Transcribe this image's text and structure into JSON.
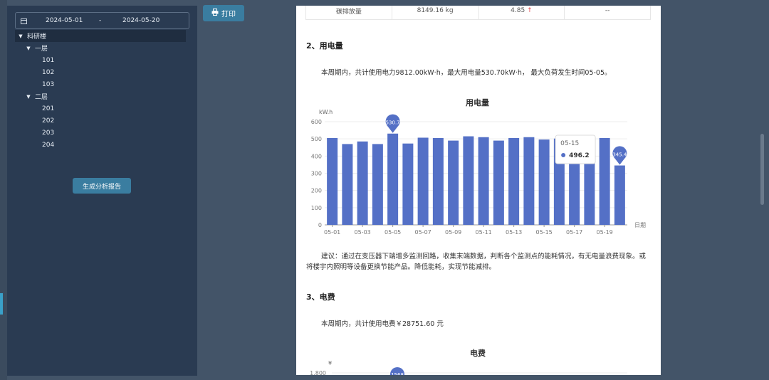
{
  "sidebar": {
    "date_from": "2024-05-01",
    "date_sep": "-",
    "date_to": "2024-05-20",
    "tree": {
      "root": "科研楼",
      "floors": [
        {
          "label": "一层",
          "rooms": [
            "101",
            "102",
            "103"
          ]
        },
        {
          "label": "二层",
          "rooms": [
            "201",
            "202",
            "203",
            "204"
          ]
        }
      ]
    },
    "generate_label": "生成分析报告"
  },
  "toolbar": {
    "print_label": "打印"
  },
  "report": {
    "table_row": {
      "name": "碳排放量",
      "value": "8149.16 kg",
      "change": "4.85",
      "trend_arrow": "↑",
      "last": "--"
    },
    "section2": {
      "title": "2、用电量",
      "summary": "本周期内，共计使用电力9812.00kW·h，最大用电量530.70kW·h，  最大负荷发生时间05-05。",
      "advice": "建议：通过在变压器下端增多监测回路，收集末端数据，判断各个监测点的能耗情况，有无电量浪费现象。或将楼宇内照明等设备更换节能产品。降低能耗，实现节能减排。"
    },
    "section3": {
      "title": "3、电费",
      "summary": "本周期内，共计使用电费￥28751.60 元"
    }
  },
  "chart_data": [
    {
      "type": "bar",
      "title": "用电量",
      "ylabel": "kW.h",
      "xlabel": "日期",
      "ylim": [
        0,
        600
      ],
      "yticks": [
        0,
        100,
        200,
        300,
        400,
        500,
        600
      ],
      "categories": [
        "05-01",
        "05-02",
        "05-03",
        "05-04",
        "05-05",
        "05-06",
        "05-07",
        "05-08",
        "05-09",
        "05-10",
        "05-11",
        "05-12",
        "05-13",
        "05-14",
        "05-15",
        "05-16",
        "05-17",
        "05-18",
        "05-19",
        "05-20"
      ],
      "xtick_labels": [
        "05-01",
        "05-03",
        "05-05",
        "05-07",
        "05-09",
        "05-11",
        "05-13",
        "05-15",
        "05-17",
        "05-19"
      ],
      "values": [
        505,
        470,
        485,
        470,
        530.7,
        473,
        507,
        505,
        490,
        515,
        510,
        490,
        505,
        510,
        496.2,
        502,
        485,
        490,
        505,
        345.4
      ],
      "color": "#5470c6",
      "markers": [
        {
          "category": "05-05",
          "label": "530.7"
        },
        {
          "category": "05-20",
          "label": "345.4"
        }
      ],
      "tooltip": {
        "category": "05-15",
        "value": "496.2"
      }
    },
    {
      "type": "bar",
      "title": "电费",
      "ylabel": "¥",
      "yticks_visible": [
        "1,800"
      ],
      "marker_label": "1568"
    }
  ]
}
